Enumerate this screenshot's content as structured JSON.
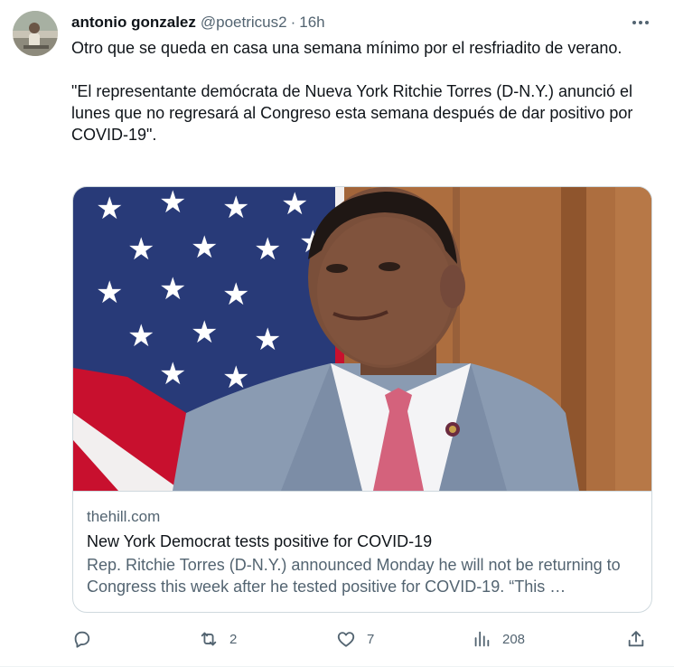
{
  "tweet": {
    "author_name": "antonio gonzalez",
    "handle": "@poetricus2",
    "separator": "·",
    "time": "16h",
    "text": "Otro que se queda en casa una semana mínimo por el resfriadito de verano.\n\n\"El representante demócrata de Nueva York Ritchie Torres (D-N.Y.) anunció el lunes que no regresará al Congreso esta semana después de dar positivo por COVID-19\"."
  },
  "card": {
    "domain": "thehill.com",
    "title": "New York Democrat tests positive for COVID-19",
    "description": "Rep. Ritchie Torres (D-N.Y.) announced Monday he will not be returning to Congress this week after he tested positive for COVID-19. “This …"
  },
  "actions": {
    "reply_count": "",
    "retweet_count": "2",
    "like_count": "7",
    "views_count": "208"
  },
  "icons": {
    "more": "more-horizontal-icon",
    "reply": "reply-icon",
    "retweet": "retweet-icon",
    "like": "heart-icon",
    "views": "bar-chart-icon",
    "share": "share-icon"
  },
  "colors": {
    "text_primary": "#0f1419",
    "text_secondary": "#536471",
    "border": "#cfd9de"
  }
}
